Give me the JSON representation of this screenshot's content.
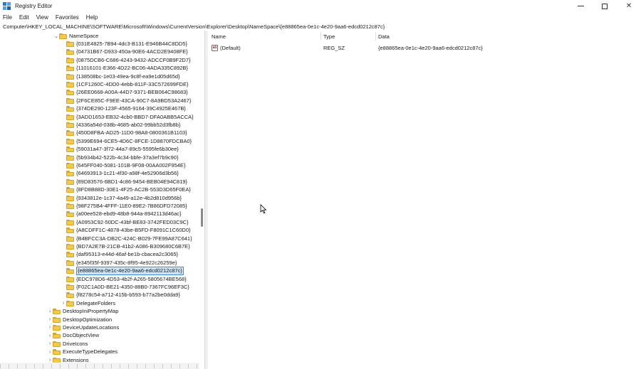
{
  "window": {
    "title": "Registry Editor"
  },
  "menu": [
    "File",
    "Edit",
    "View",
    "Favorites",
    "Help"
  ],
  "address": "Computer\\HKEY_LOCAL_MACHINE\\SOFTWARE\\Microsoft\\Windows\\CurrentVersion\\Explorer\\Desktop\\NameSpace\\{e88865ea-0e1c-4e20-9aa6-edcd0212c87c}",
  "tree": {
    "namespace": "NameSpace",
    "keys": [
      "{031E4825-7B94-4dc3-B131-E946B44C8DD5}",
      "{04731B67-D933-450a-90E6-4ACD2E9408FE}",
      "{0875DCB6-C686-4243-9432-ADCCF0B9F2D7}",
      "{11016101-E366-4D22-BC06-4ADA335C892B}",
      "{138508bc-1e03-49ea-9c8f-ea9e1d05d65d}",
      "{1CF1260C-4DD0-4ebb-811F-33C572699FDE}",
      "{26EE0668-A00A-44D7-9371-BEB064C98683}",
      "{2F6CE85C-F9EE-43CA-90C7-8A9BD53A2467}",
      "{374DE290-123F-4565-9164-39C4925E467B}",
      "{3ADD1653-EB32-4cb0-BBD7-DFA0ABB5ACCA}",
      "{4336a54d-038b-4685-ab02-99bb52d3fb8b}",
      "{450D8FBA-AD25-11D0-98A8-0800361B1103}",
      "{5399E694-6CE5-4D6C-8FCE-1D8870FDCBA0}",
      "{59031a47-3f72-44a7-89c5-5595fe6b30ee}",
      "{5b934b42-522b-4c34-bbfe-37a3ef7b9c90}",
      "{645FF040-5081-101B-9F08-00AA002F954E}",
      "{64693913-1c21-4f30-a98f-4e52906d3b56}",
      "{89D83576-6BD1-4c86-9454-BEB04E94C819}",
      "{8FD8B88D-30E1-4F25-AC2B-553D3D65F0EA}",
      "{9343812e-1c37-4a49-a12e-4b2d810d956b}",
      "{98F275B4-4FFF-11E0-89E2-7B86DFD72085}",
      "{a00ee528-ebd9-48b8-944a-8942113d46ac}",
      "{A0953C92-50DC-43bf-BE83-3742FED03C9C}",
      "{A8CDFF1C-4878-43be-B5FD-F8091C1C60D0}",
      "{B4BFCC3A-DB2C-424C-B029-7FE99A87C641}",
      "{BD7A2E7B-21CB-41b2-A086-B309680C6B7E}",
      "{daf95313-e44d-46af-be1b-cbacea2c3065}",
      "{e345f35f-9397-435c-8f95-4e922c26259e}",
      "{e88865ea-0e1c-4e20-9aa6-edcd0212c87c}",
      "{EDC978D6-4D53-4b2f-A265-5805674BE568}",
      "{F02C1A0D-BE21-4350-88B0-7367FC96EF3C}",
      "{f8278c54-a712-415b-b593-b77a2be0dda9}"
    ],
    "selected_index": 28,
    "delegate": "DelegateFolders",
    "siblings": [
      "DesktopIniPropertyMap",
      "DesktopOptimization",
      "DeviceUpdateLocations",
      "DocObjectView",
      "DriveIcons",
      "ExecuteTypeDelegates",
      "Extensions"
    ]
  },
  "list": {
    "columns": {
      "name": "Name",
      "type": "Type",
      "data": "Data"
    },
    "rows": [
      {
        "name": "(Default)",
        "type": "REG_SZ",
        "data": "{e88865ea-0e1c-4e20-9aa6-edcd0212c87c}",
        "icon": "ab-icon"
      }
    ]
  }
}
